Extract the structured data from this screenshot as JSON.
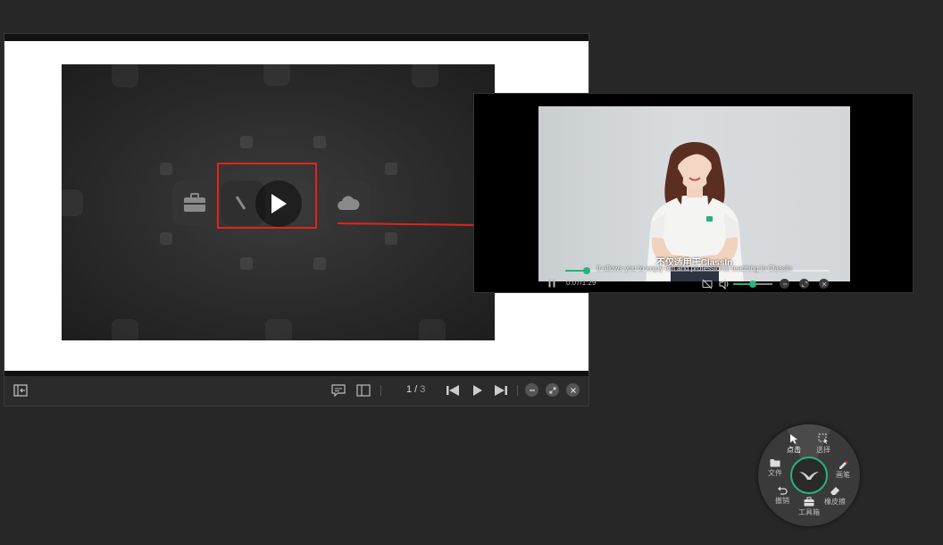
{
  "viewer": {
    "page_current": "1",
    "page_separator": " / ",
    "page_total": "3",
    "icons": [
      "fit-to-window-icon",
      "annotation-icon",
      "slide-list-icon",
      "first-page-icon",
      "play-icon",
      "next-page-icon",
      "minimize-icon",
      "restore-icon",
      "close-icon"
    ]
  },
  "player": {
    "subtitle_cn": "不仅适用于ClassIn",
    "subtitle_en": "It allows you to enjoy fun and professional teaching in ClassIn",
    "time": "0:07/1:29",
    "progress": 0.08,
    "volume": 0.5
  },
  "tool_menu": {
    "items": [
      {
        "label": "点击",
        "icon": "cursor-icon",
        "active": true
      },
      {
        "label": "选择",
        "icon": "select-icon"
      },
      {
        "label": "画笔",
        "icon": "pen-icon"
      },
      {
        "label": "橡皮擦",
        "icon": "eraser-icon"
      },
      {
        "label": "工具箱",
        "icon": "toolbox-icon"
      },
      {
        "label": "撤销",
        "icon": "undo-icon"
      },
      {
        "label": "文件",
        "icon": "folder-icon"
      }
    ]
  },
  "colors": {
    "background": "#272727",
    "highlight": "#e3231c",
    "accent": "#27b37d"
  }
}
